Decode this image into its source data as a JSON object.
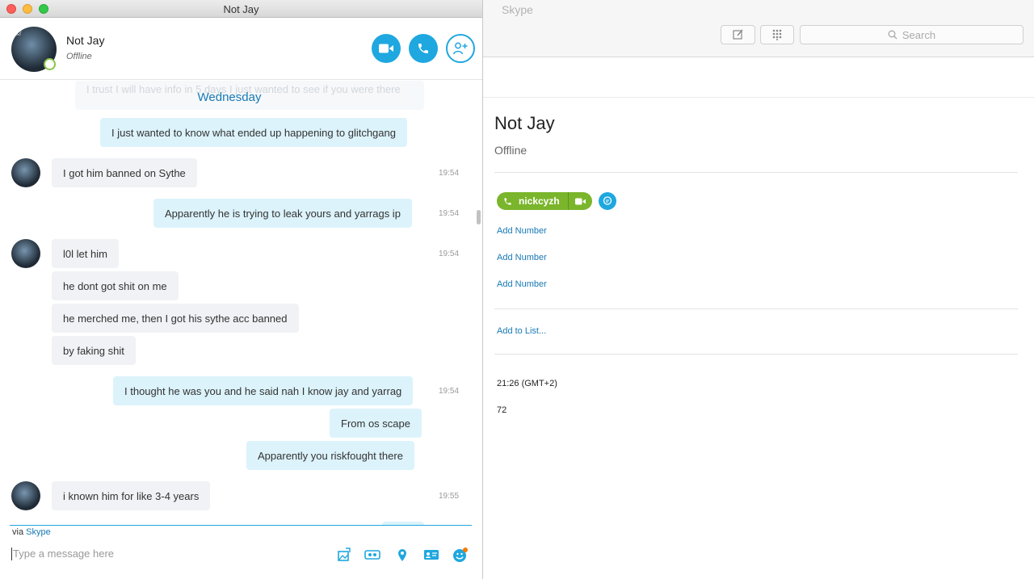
{
  "chat_window": {
    "title": "Not Jay",
    "contact_name": "Not Jay",
    "contact_status": "Offline",
    "day_label": "Wednesday",
    "faded_message": "I trust I will have info in 5 days I just wanted to see if you were there",
    "messages": [
      {
        "dir": "out",
        "text": "I just wanted to know what ended up happening to glitchgang",
        "time": ""
      },
      {
        "dir": "in",
        "text": "I got him banned on Sythe",
        "time": "19:54"
      },
      {
        "dir": "out",
        "text": "Apparently he is trying to leak yours and yarrags ip",
        "time": "19:54"
      },
      {
        "dir": "in",
        "text": "l0l let him",
        "time": "19:54"
      },
      {
        "dir": "in",
        "text": "he dont got shit on me",
        "time": ""
      },
      {
        "dir": "in",
        "text": "he merched me, then I got his sythe acc banned",
        "time": ""
      },
      {
        "dir": "in",
        "text": "by faking shit",
        "time": ""
      },
      {
        "dir": "out",
        "text": "I thought he was you and he said nah I know jay and yarrag",
        "time": "19:54"
      },
      {
        "dir": "out",
        "text": "From os scape",
        "time": ""
      },
      {
        "dir": "out",
        "text": "Apparently you riskfought there",
        "time": ""
      },
      {
        "dir": "in",
        "text": "i known him for like 3-4 years",
        "time": "19:55"
      }
    ],
    "via_prefix": "via",
    "via_link": "Skype",
    "compose_placeholder": "Type a message here"
  },
  "main_window": {
    "title": "Skype",
    "search_placeholder": "Search",
    "profile_name": "Not Jay",
    "profile_status": "Offline",
    "skype_id": "nickcyzh",
    "add_number_label": "Add Number",
    "add_to_list_label": "Add to List...",
    "local_time": "21:26 (GMT+2)",
    "age": "72"
  },
  "colors": {
    "accent": "#1fa7e0",
    "link": "#1879b5",
    "online_green": "#7ab52b",
    "bubble_out": "#dcf3fb",
    "bubble_in": "#f0f2f5"
  },
  "icons": [
    "video-call-icon",
    "phone-icon",
    "add-contact-icon",
    "compose-icon",
    "dialpad-icon",
    "search-icon",
    "chat-icon",
    "image-icon",
    "video-message-icon",
    "location-icon",
    "contact-card-icon",
    "emoticon-icon"
  ]
}
